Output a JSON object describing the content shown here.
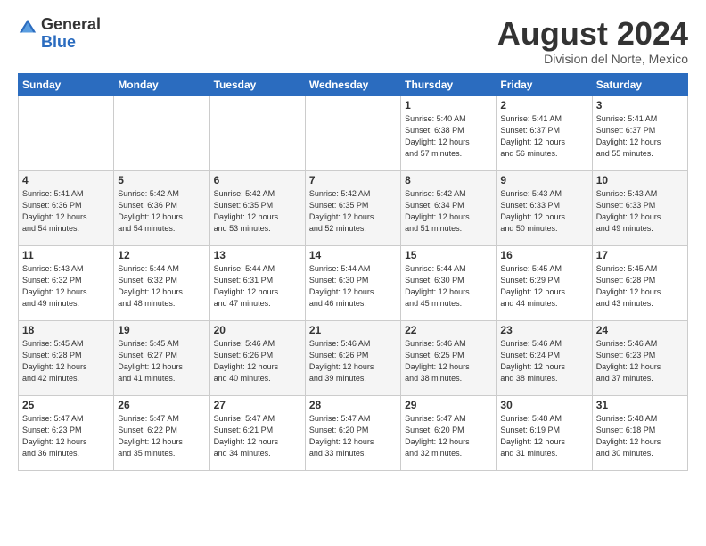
{
  "logo": {
    "general": "General",
    "blue": "Blue"
  },
  "header": {
    "month": "August 2024",
    "location": "Division del Norte, Mexico"
  },
  "days_of_week": [
    "Sunday",
    "Monday",
    "Tuesday",
    "Wednesday",
    "Thursday",
    "Friday",
    "Saturday"
  ],
  "weeks": [
    [
      {
        "day": "",
        "info": ""
      },
      {
        "day": "",
        "info": ""
      },
      {
        "day": "",
        "info": ""
      },
      {
        "day": "",
        "info": ""
      },
      {
        "day": "1",
        "info": "Sunrise: 5:40 AM\nSunset: 6:38 PM\nDaylight: 12 hours\nand 57 minutes."
      },
      {
        "day": "2",
        "info": "Sunrise: 5:41 AM\nSunset: 6:37 PM\nDaylight: 12 hours\nand 56 minutes."
      },
      {
        "day": "3",
        "info": "Sunrise: 5:41 AM\nSunset: 6:37 PM\nDaylight: 12 hours\nand 55 minutes."
      }
    ],
    [
      {
        "day": "4",
        "info": "Sunrise: 5:41 AM\nSunset: 6:36 PM\nDaylight: 12 hours\nand 54 minutes."
      },
      {
        "day": "5",
        "info": "Sunrise: 5:42 AM\nSunset: 6:36 PM\nDaylight: 12 hours\nand 54 minutes."
      },
      {
        "day": "6",
        "info": "Sunrise: 5:42 AM\nSunset: 6:35 PM\nDaylight: 12 hours\nand 53 minutes."
      },
      {
        "day": "7",
        "info": "Sunrise: 5:42 AM\nSunset: 6:35 PM\nDaylight: 12 hours\nand 52 minutes."
      },
      {
        "day": "8",
        "info": "Sunrise: 5:42 AM\nSunset: 6:34 PM\nDaylight: 12 hours\nand 51 minutes."
      },
      {
        "day": "9",
        "info": "Sunrise: 5:43 AM\nSunset: 6:33 PM\nDaylight: 12 hours\nand 50 minutes."
      },
      {
        "day": "10",
        "info": "Sunrise: 5:43 AM\nSunset: 6:33 PM\nDaylight: 12 hours\nand 49 minutes."
      }
    ],
    [
      {
        "day": "11",
        "info": "Sunrise: 5:43 AM\nSunset: 6:32 PM\nDaylight: 12 hours\nand 49 minutes."
      },
      {
        "day": "12",
        "info": "Sunrise: 5:44 AM\nSunset: 6:32 PM\nDaylight: 12 hours\nand 48 minutes."
      },
      {
        "day": "13",
        "info": "Sunrise: 5:44 AM\nSunset: 6:31 PM\nDaylight: 12 hours\nand 47 minutes."
      },
      {
        "day": "14",
        "info": "Sunrise: 5:44 AM\nSunset: 6:30 PM\nDaylight: 12 hours\nand 46 minutes."
      },
      {
        "day": "15",
        "info": "Sunrise: 5:44 AM\nSunset: 6:30 PM\nDaylight: 12 hours\nand 45 minutes."
      },
      {
        "day": "16",
        "info": "Sunrise: 5:45 AM\nSunset: 6:29 PM\nDaylight: 12 hours\nand 44 minutes."
      },
      {
        "day": "17",
        "info": "Sunrise: 5:45 AM\nSunset: 6:28 PM\nDaylight: 12 hours\nand 43 minutes."
      }
    ],
    [
      {
        "day": "18",
        "info": "Sunrise: 5:45 AM\nSunset: 6:28 PM\nDaylight: 12 hours\nand 42 minutes."
      },
      {
        "day": "19",
        "info": "Sunrise: 5:45 AM\nSunset: 6:27 PM\nDaylight: 12 hours\nand 41 minutes."
      },
      {
        "day": "20",
        "info": "Sunrise: 5:46 AM\nSunset: 6:26 PM\nDaylight: 12 hours\nand 40 minutes."
      },
      {
        "day": "21",
        "info": "Sunrise: 5:46 AM\nSunset: 6:26 PM\nDaylight: 12 hours\nand 39 minutes."
      },
      {
        "day": "22",
        "info": "Sunrise: 5:46 AM\nSunset: 6:25 PM\nDaylight: 12 hours\nand 38 minutes."
      },
      {
        "day": "23",
        "info": "Sunrise: 5:46 AM\nSunset: 6:24 PM\nDaylight: 12 hours\nand 38 minutes."
      },
      {
        "day": "24",
        "info": "Sunrise: 5:46 AM\nSunset: 6:23 PM\nDaylight: 12 hours\nand 37 minutes."
      }
    ],
    [
      {
        "day": "25",
        "info": "Sunrise: 5:47 AM\nSunset: 6:23 PM\nDaylight: 12 hours\nand 36 minutes."
      },
      {
        "day": "26",
        "info": "Sunrise: 5:47 AM\nSunset: 6:22 PM\nDaylight: 12 hours\nand 35 minutes."
      },
      {
        "day": "27",
        "info": "Sunrise: 5:47 AM\nSunset: 6:21 PM\nDaylight: 12 hours\nand 34 minutes."
      },
      {
        "day": "28",
        "info": "Sunrise: 5:47 AM\nSunset: 6:20 PM\nDaylight: 12 hours\nand 33 minutes."
      },
      {
        "day": "29",
        "info": "Sunrise: 5:47 AM\nSunset: 6:20 PM\nDaylight: 12 hours\nand 32 minutes."
      },
      {
        "day": "30",
        "info": "Sunrise: 5:48 AM\nSunset: 6:19 PM\nDaylight: 12 hours\nand 31 minutes."
      },
      {
        "day": "31",
        "info": "Sunrise: 5:48 AM\nSunset: 6:18 PM\nDaylight: 12 hours\nand 30 minutes."
      }
    ]
  ]
}
